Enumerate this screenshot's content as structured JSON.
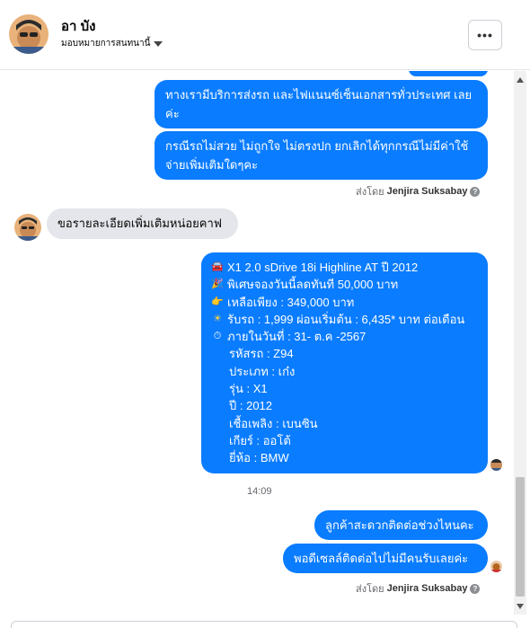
{
  "header": {
    "name": "อา บัง",
    "subtitle": "มอบหมายการสนทนานี้"
  },
  "messages": {
    "out_top_1": "ทางเรามีบริการส่งรถ และไฟแนนซ์เซ็นเอกสารทั่วประเทศ เลยค่ะ",
    "out_top_2": "กรณีรถไม่สวย ไม่ถูกใจ ไม่ตรงปก ยกเลิกได้ทุกกรณีไม่มีค่าใช้จ่ายเพิ่มเติมใดๆคะ",
    "sent_by_prefix_1": "ส่งโดย",
    "sent_by_name_1": "Jenjira Suksabay",
    "incoming": "ขอรายละเอียดเพิ่มเติมหน่อยคาฟ",
    "details": [
      {
        "icon": "car-emoji",
        "glyph": "🚘",
        "text": "X1 2.0 sDrive 18i Highline AT ปี 2012"
      },
      {
        "icon": "party-emoji",
        "glyph": "🎉",
        "text": "พิเศษจองวันนี้ลดทันที 50,000 บาท"
      },
      {
        "icon": "point-right-emoji",
        "glyph": "👉",
        "text": "เหลือเพียง : 349,000 บาท"
      },
      {
        "icon": "sun-emoji",
        "glyph": "☀",
        "text": "รับรถ : 1,999 ผ่อนเริ่มต้น : 6,435* บาท ต่อเดือน"
      },
      {
        "icon": "stopwatch-emoji",
        "glyph": "⏱",
        "text": "ภายในวันที่ : 31- ต.ค -2567"
      }
    ],
    "specs": [
      "รหัสรถ : Z94",
      "ประเภท : เก๋ง",
      "รุ่น : X1",
      "ปี : 2012",
      "เชื้อเพลิง : เบนซิน",
      "เกียร์ : ออโต้",
      "ยี่ห้อ : BMW"
    ],
    "timestamp": "14:09",
    "out_bottom_1": "ลูกค้าสะดวกติดต่อช่วงไหนคะ",
    "out_bottom_2": "พอดีเซลล์ติดต่อไปไม่มีคนรับเลยค่ะ",
    "sent_by_prefix_2": "ส่งโดย",
    "sent_by_name_2": "Jenjira Suksabay"
  },
  "colors": {
    "outgoing_bubble": "#0a7cff",
    "incoming_bubble": "#e4e6eb"
  }
}
